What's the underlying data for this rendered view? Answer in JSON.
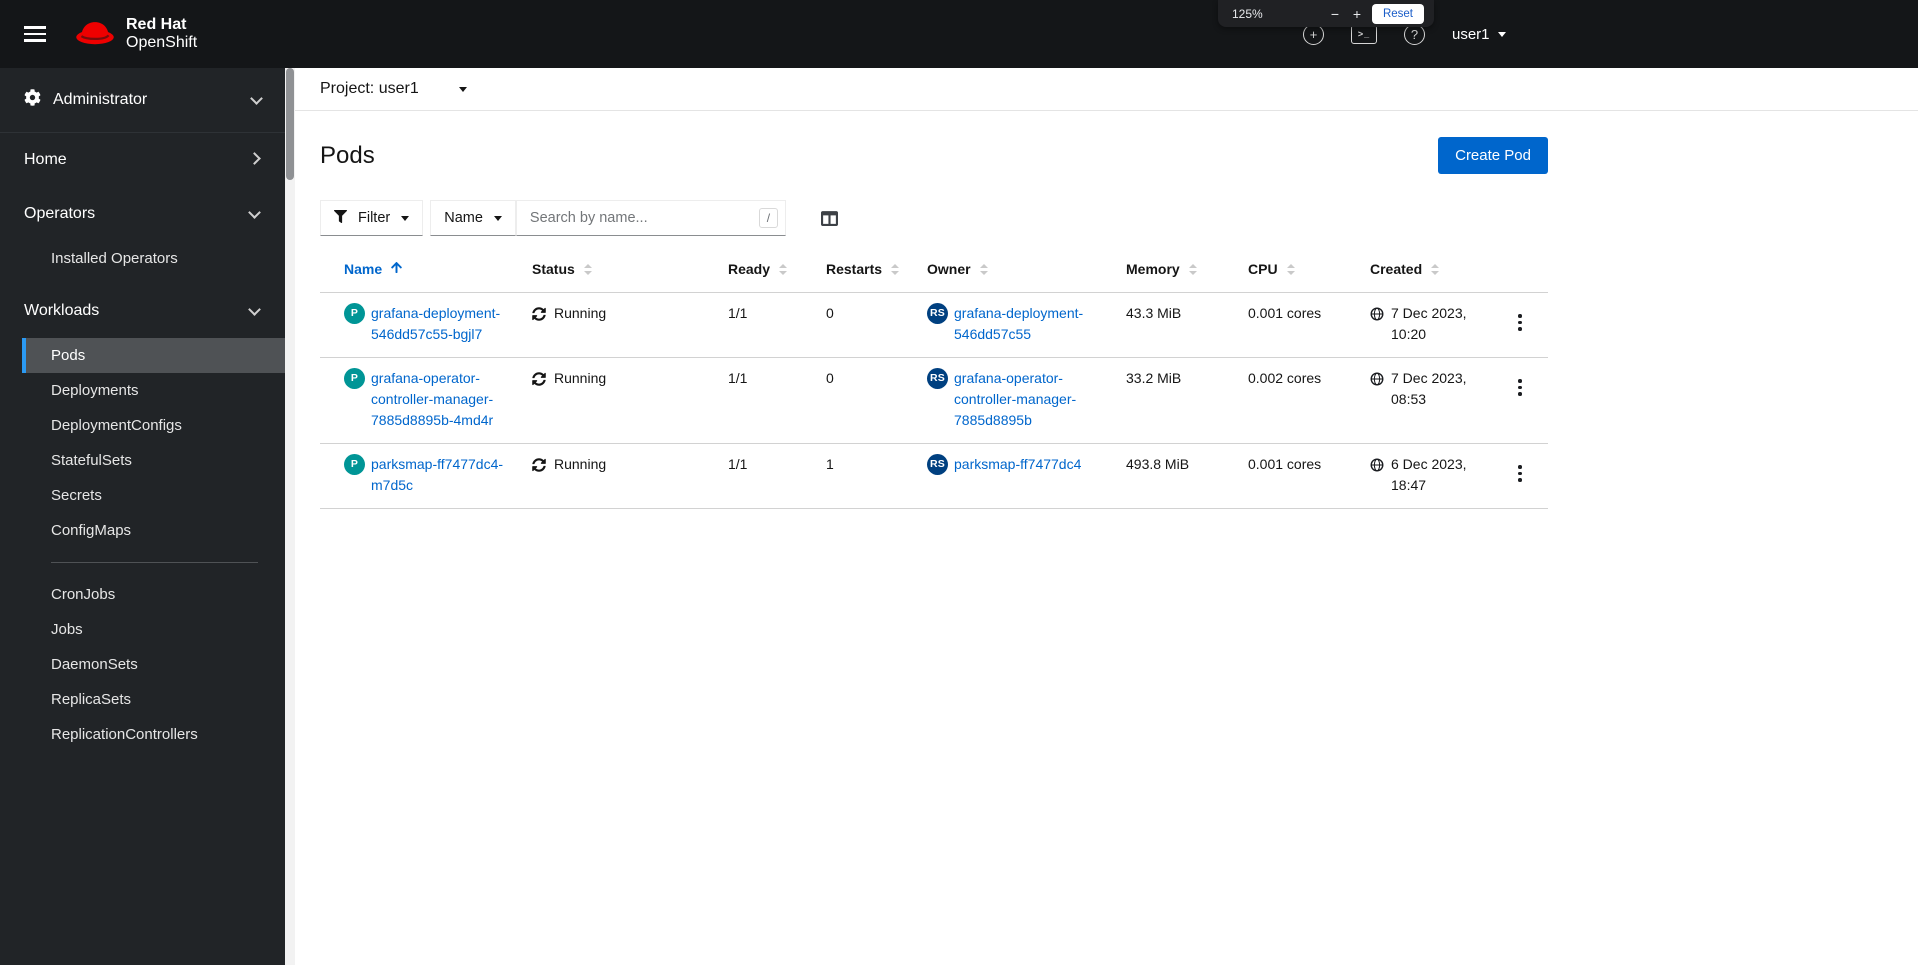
{
  "masthead": {
    "brand_line1": "Red Hat",
    "brand_line2": "OpenShift",
    "icon_plus": "+",
    "icon_terminal": ">_",
    "icon_question": "?",
    "user": "user1"
  },
  "zoom_overlay": {
    "level": "125%",
    "minus": "−",
    "plus": "+",
    "reset": "Reset"
  },
  "sidebar": {
    "perspective": "Administrator",
    "groups": [
      {
        "label": "Home",
        "expanded": false,
        "items": []
      },
      {
        "label": "Operators",
        "expanded": true,
        "items": [
          {
            "label": "Installed Operators"
          }
        ]
      },
      {
        "label": "Workloads",
        "expanded": true,
        "items": [
          {
            "label": "Pods",
            "active": true
          },
          {
            "label": "Deployments"
          },
          {
            "label": "DeploymentConfigs"
          },
          {
            "label": "StatefulSets"
          },
          {
            "label": "Secrets"
          },
          {
            "label": "ConfigMaps"
          },
          {
            "divider": true
          },
          {
            "label": "CronJobs"
          },
          {
            "label": "Jobs"
          },
          {
            "label": "DaemonSets"
          },
          {
            "label": "ReplicaSets"
          },
          {
            "label": "ReplicationControllers"
          }
        ]
      }
    ]
  },
  "project_bar": {
    "label": "Project: user1"
  },
  "page": {
    "title": "Pods",
    "create_button": "Create Pod"
  },
  "toolbar": {
    "filter_label": "Filter",
    "attribute_label": "Name",
    "search_placeholder": "Search by name...",
    "shortcut": "/"
  },
  "table": {
    "columns": [
      "Name",
      "Status",
      "Ready",
      "Restarts",
      "Owner",
      "Memory",
      "CPU",
      "Created"
    ],
    "sort": {
      "column": "Name",
      "direction": "asc"
    },
    "rows": [
      {
        "badge": "P",
        "name": "grafana-deployment-546dd57c55-bgjl7",
        "status": "Running",
        "ready": "1/1",
        "restarts": "0",
        "owner_badge": "RS",
        "owner": "grafana-deployment-546dd57c55",
        "memory": "43.3 MiB",
        "cpu": "0.001 cores",
        "created": "7 Dec 2023, 10:20"
      },
      {
        "badge": "P",
        "name": "grafana-operator-controller-manager-7885d8895b-4md4r",
        "status": "Running",
        "ready": "1/1",
        "restarts": "0",
        "owner_badge": "RS",
        "owner": "grafana-operator-controller-manager-7885d8895b",
        "memory": "33.2 MiB",
        "cpu": "0.002 cores",
        "created": "7 Dec 2023, 08:53"
      },
      {
        "badge": "P",
        "name": "parksmap-ff7477dc4-m7d5c",
        "status": "Running",
        "ready": "1/1",
        "restarts": "1",
        "owner_badge": "RS",
        "owner": "parksmap-ff7477dc4",
        "memory": "493.8 MiB",
        "cpu": "0.001 cores",
        "created": "6 Dec 2023, 18:47"
      }
    ]
  },
  "colors": {
    "accent_blue": "#0066cc",
    "masthead_bg": "#141618",
    "sidebar_bg": "#212427",
    "nav_active_bg": "#4f5255",
    "nav_active_border": "#2b9af3",
    "pod_badge": "#009596",
    "replicaset_badge": "#004080",
    "border": "#d2d2d2"
  }
}
